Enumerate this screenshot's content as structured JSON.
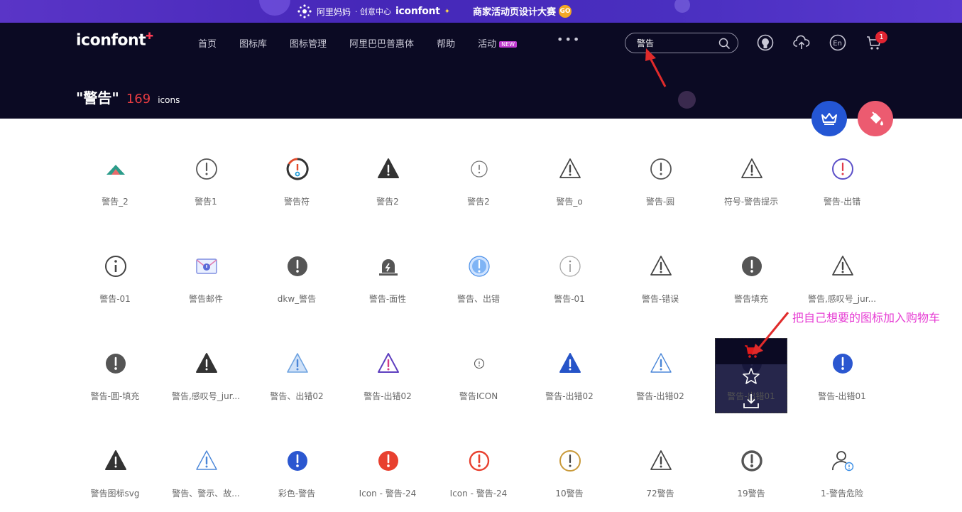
{
  "promo": {
    "brand": "阿里妈妈",
    "sub": "· 创意中心",
    "logo": "iconfont",
    "campaign": "商家活动页设计大赛",
    "badge": "GO"
  },
  "header": {
    "logo": "iconfont",
    "nav": [
      "首页",
      "图标库",
      "图标管理",
      "阿里巴巴普惠体",
      "帮助",
      "活动"
    ],
    "new_badge": "NEW",
    "more": "•••",
    "search_value": "警告",
    "cart_count": "1"
  },
  "result": {
    "query": "\"警告\"",
    "count": "169",
    "unit": "icons"
  },
  "icons": [
    {
      "label": "警告_2",
      "icon": "mountain-warning-icon"
    },
    {
      "label": "警告1",
      "icon": "circle-exclamation-outline-icon"
    },
    {
      "label": "警告符",
      "icon": "circle-exclamation-colored-icon"
    },
    {
      "label": "警告2",
      "icon": "triangle-filled-icon"
    },
    {
      "label": "警告2",
      "icon": "circle-exclamation-thin-icon"
    },
    {
      "label": "警告_o",
      "icon": "triangle-outline-icon"
    },
    {
      "label": "警告-圆",
      "icon": "circle-exclamation-outline-icon"
    },
    {
      "label": "符号-警告提示",
      "icon": "triangle-outline-icon"
    },
    {
      "label": "警告-出错",
      "icon": "circle-exclamation-purple-icon"
    },
    {
      "label": "警告-01",
      "icon": "circle-info-icon"
    },
    {
      "label": "警告邮件",
      "icon": "mail-warning-icon"
    },
    {
      "label": "dkw_警告",
      "icon": "circle-exclamation-filled-icon"
    },
    {
      "label": "警告-面性",
      "icon": "alarm-lamp-icon"
    },
    {
      "label": "警告、出错",
      "icon": "circle-exclamation-blue-icon"
    },
    {
      "label": "警告-01",
      "icon": "circle-info-thin-icon"
    },
    {
      "label": "警告-错误",
      "icon": "triangle-outline-icon"
    },
    {
      "label": "警告填充",
      "icon": "circle-exclamation-filled-icon"
    },
    {
      "label": "警告,感叹号_jur...",
      "icon": "triangle-outline-icon"
    },
    {
      "label": "警告-圆-填充",
      "icon": "circle-exclamation-filled-icon"
    },
    {
      "label": "警告,感叹号_jur...",
      "icon": "triangle-filled-icon"
    },
    {
      "label": "警告、出错02",
      "icon": "triangle-blue-light-icon"
    },
    {
      "label": "警告-出错02",
      "icon": "triangle-purple-icon"
    },
    {
      "label": "警告ICON",
      "icon": "circle-exclamation-tiny-icon"
    },
    {
      "label": "警告-出错02",
      "icon": "triangle-blue-filled-icon"
    },
    {
      "label": "警告-出错02",
      "icon": "triangle-blue-outline-icon"
    },
    {
      "label": "警告-出错01",
      "icon": "circle-exclamation-filled-icon"
    },
    {
      "label": "警告-出错01",
      "icon": "circle-exclamation-blue-filled-icon"
    },
    {
      "label": "警告图标svg",
      "icon": "triangle-filled-icon"
    },
    {
      "label": "警告、警示、故...",
      "icon": "triangle-blue-outline-icon"
    },
    {
      "label": "彩色-警告",
      "icon": "circle-exclamation-blue-filled-icon"
    },
    {
      "label": "Icon - 警告-24",
      "icon": "circle-exclamation-red-filled-icon"
    },
    {
      "label": "Icon - 警告-24",
      "icon": "circle-exclamation-red-outline-icon"
    },
    {
      "label": "10警告",
      "icon": "circle-exclamation-gold-icon"
    },
    {
      "label": "72警告",
      "icon": "triangle-outline-icon"
    },
    {
      "label": "19警告",
      "icon": "circle-exclamation-thick-icon"
    },
    {
      "label": "1-警告危险",
      "icon": "user-warning-icon"
    }
  ],
  "annotation": "把自己想要的图标加入购物车",
  "colors": {
    "promo_bg": "#4527b8",
    "header_bg": "#0b0a23",
    "count_red": "#e73c42",
    "annotation": "#e63cd3",
    "fab_blue": "#2456d4",
    "fab_pink": "#ec5b70"
  }
}
